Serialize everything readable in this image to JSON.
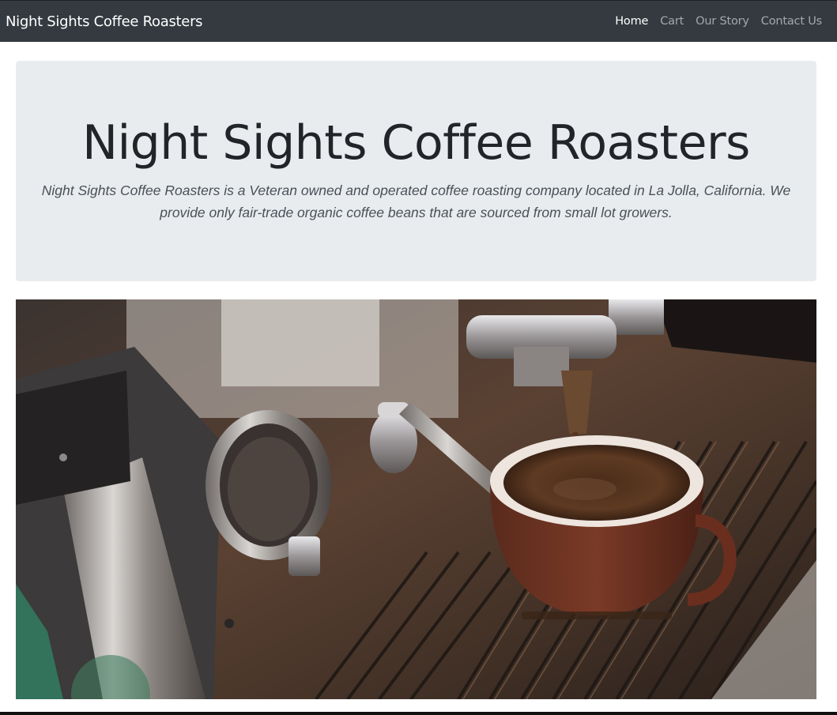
{
  "navbar": {
    "brand": "Night Sights Coffee Roasters",
    "links": [
      {
        "label": "Home",
        "active": true
      },
      {
        "label": "Cart",
        "active": false
      },
      {
        "label": "Our Story",
        "active": false
      },
      {
        "label": "Contact Us",
        "active": false
      }
    ]
  },
  "jumbotron": {
    "title": "Night Sights Coffee Roasters",
    "lead": "Night Sights Coffee Roasters is a Veteran owned and operated coffee roasting company located in La Jolla, California. We provide only fair-trade organic coffee beans that are sourced from small lot growers."
  },
  "colors": {
    "navbar_bg": "#343a40",
    "jumbotron_bg": "#e9ecef",
    "title_text": "#212529",
    "lead_text": "#495057"
  }
}
